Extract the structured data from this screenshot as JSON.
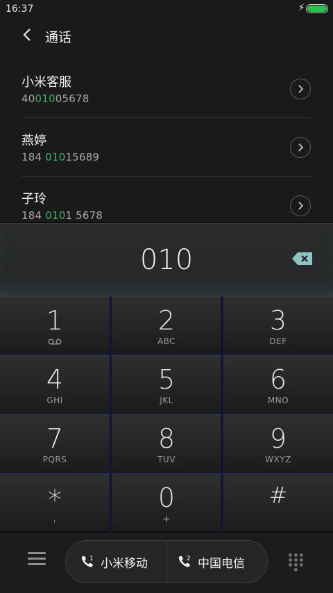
{
  "status_bar": {
    "time": "16:37",
    "charging_icon": "⚡",
    "battery_color": "#27c24c"
  },
  "header": {
    "title": "通话"
  },
  "accent_color": "#3fb06a",
  "contacts": [
    {
      "name": "小米客服",
      "number_pre": "40",
      "number_match": "010",
      "number_post": "05678"
    },
    {
      "name": "燕婷",
      "number_pre": "184 ",
      "number_match": "010",
      "number_post": "15689"
    },
    {
      "name": "子玲",
      "number_pre": "184 ",
      "number_match": "010",
      "number_post": "1 5678"
    }
  ],
  "dialer": {
    "input": "010"
  },
  "keys": [
    {
      "num": "1",
      "sub": ""
    },
    {
      "num": "2",
      "sub": "ABC"
    },
    {
      "num": "3",
      "sub": "DEF"
    },
    {
      "num": "4",
      "sub": "GHI"
    },
    {
      "num": "5",
      "sub": "JKL"
    },
    {
      "num": "6",
      "sub": "MNO"
    },
    {
      "num": "7",
      "sub": "PQRS"
    },
    {
      "num": "8",
      "sub": "TUV"
    },
    {
      "num": "9",
      "sub": "WXYZ"
    },
    {
      "num": "*",
      "sub": ","
    },
    {
      "num": "0",
      "sub": "+"
    },
    {
      "num": "#",
      "sub": ""
    }
  ],
  "sims": [
    {
      "slot": "1",
      "label": "小米移动"
    },
    {
      "slot": "2",
      "label": "中国电信"
    }
  ]
}
